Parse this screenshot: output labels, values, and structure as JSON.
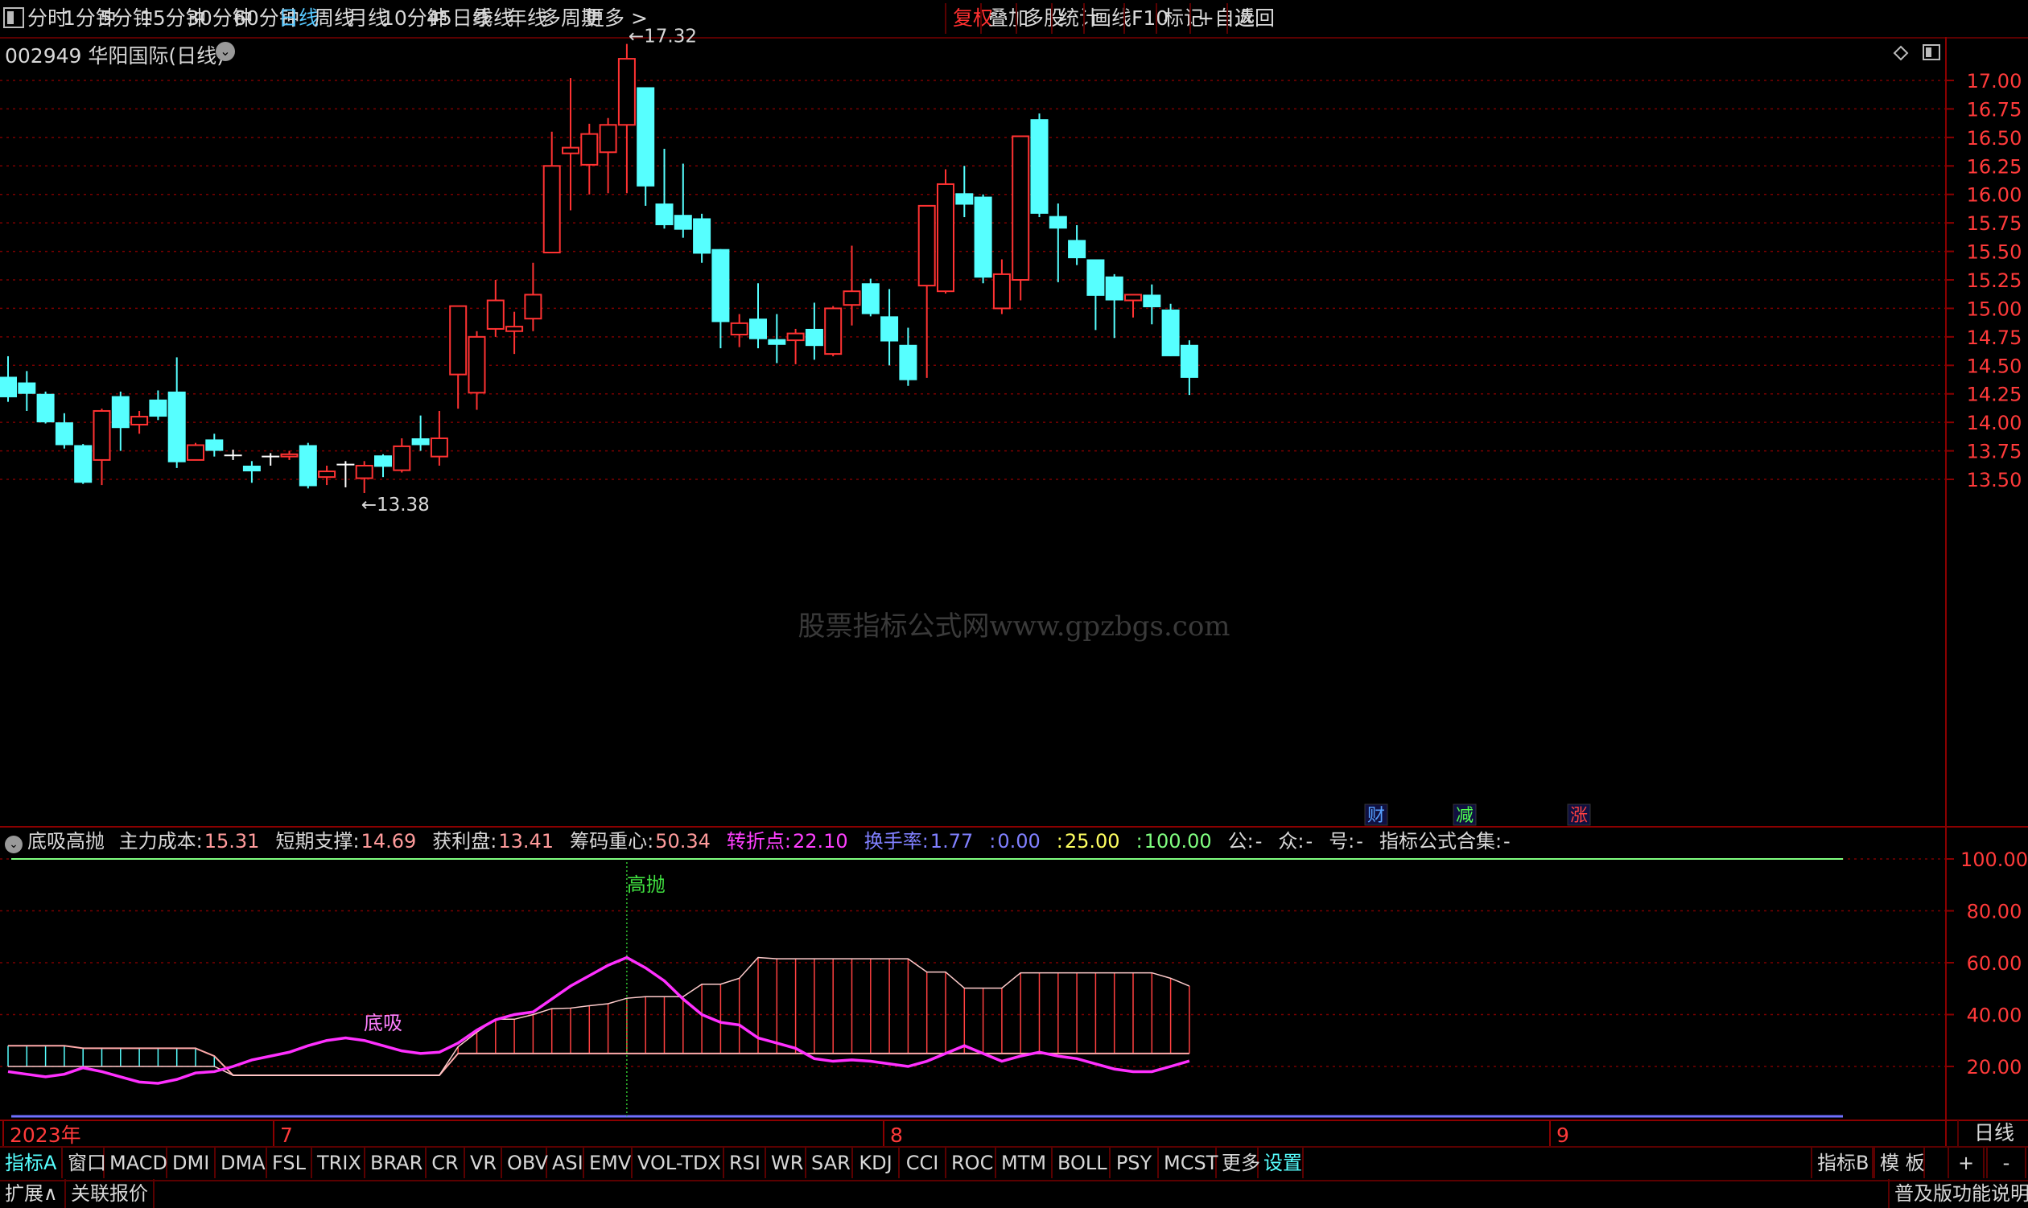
{
  "toolbar": {
    "periods": [
      "分时",
      "1分钟",
      "5分钟",
      "15分钟",
      "30分钟",
      "60分钟",
      "日线",
      "周线",
      "月线",
      "10分钟",
      "45日线",
      "季线",
      "年线",
      "多周期",
      "更多 >"
    ],
    "active_period": "日线",
    "right_buttons": [
      "复权",
      "叠加",
      "多股",
      "统计",
      "画线",
      "F10",
      "标记",
      "+自选",
      "返回"
    ]
  },
  "stock": {
    "code": "002949",
    "name": "华阳国际",
    "period": "(日线)"
  },
  "price_axis": {
    "labels": [
      "17.00",
      "16.75",
      "16.50",
      "16.25",
      "16.00",
      "15.75",
      "15.50",
      "15.25",
      "15.00",
      "14.75",
      "14.50",
      "14.25",
      "14.00",
      "13.75",
      "13.50"
    ],
    "min": 13.2,
    "max": 17.4
  },
  "annotations": {
    "high": "17.32",
    "low": "13.38",
    "markers": [
      "财",
      "减",
      "涨"
    ]
  },
  "watermark": "股票指标公式网www.gpzbgs.com",
  "indicator": {
    "name": "底吸高抛",
    "fields": [
      {
        "label": "主力成本:",
        "value": "15.31",
        "color": "#ff9b9b"
      },
      {
        "label": "短期支撑:",
        "value": "14.69",
        "color": "#ff9b9b"
      },
      {
        "label": "获利盘:",
        "value": "13.41",
        "color": "#ff9b9b"
      },
      {
        "label": "筹码重心:",
        "value": "50.34",
        "color": "#ff9b9b"
      },
      {
        "label": "转折点:",
        "value": "22.10",
        "color": "#ff40ff"
      },
      {
        "label": "换手率:",
        "value": "1.77",
        "color": "#8080ff"
      },
      {
        "label": ":",
        "value": "0.00",
        "color": "#8080ff"
      },
      {
        "label": ":",
        "value": "25.00",
        "color": "#ffff60"
      },
      {
        "label": ":",
        "value": "100.00",
        "color": "#80ff80"
      },
      {
        "label": "公:",
        "value": "-",
        "color": "#d8d8d8"
      },
      {
        "label": "众:",
        "value": "-",
        "color": "#d8d8d8"
      },
      {
        "label": "号:",
        "value": "-",
        "color": "#d8d8d8"
      },
      {
        "label": "指标公式合集:",
        "value": "-",
        "color": "#d8d8d8"
      }
    ],
    "axis_labels": [
      "100.00",
      "80.00",
      "60.00",
      "40.00",
      "20.00"
    ],
    "signal_buy": "底吸",
    "signal_sell": "高抛"
  },
  "date_axis": {
    "labels": [
      "2023年",
      "7",
      "8",
      "9"
    ],
    "period": "日线"
  },
  "tabs": [
    "指标A",
    "窗口",
    "MACD",
    "DMI",
    "DMA",
    "FSL",
    "TRIX",
    "BRAR",
    "CR",
    "VR",
    "OBV",
    "ASI",
    "EMV",
    "VOL-TDX",
    "RSI",
    "WR",
    "SAR",
    "KDJ",
    "CCI",
    "ROC",
    "MTM",
    "BOLL",
    "PSY",
    "MCST",
    "更多",
    "设置"
  ],
  "tabs_right": [
    "指标B",
    "模 板",
    "+",
    "-"
  ],
  "statusbar": {
    "left": [
      "扩展∧",
      "关联报价"
    ],
    "right": "普及版功能说明"
  },
  "chart_data": {
    "type": "candlestick",
    "candles": [
      [
        14.4,
        14.22,
        14.58,
        14.18
      ],
      [
        14.35,
        14.25,
        14.45,
        14.1
      ],
      [
        14.25,
        14.0,
        14.27,
        13.99
      ],
      [
        14.0,
        13.8,
        14.08,
        13.77
      ],
      [
        13.8,
        13.47,
        13.81,
        13.46
      ],
      [
        13.67,
        14.1,
        14.12,
        13.45
      ],
      [
        14.23,
        13.95,
        14.27,
        13.75
      ],
      [
        13.98,
        14.05,
        14.1,
        13.9
      ],
      [
        14.2,
        14.05,
        14.28,
        14.02
      ],
      [
        14.27,
        13.65,
        14.57,
        13.6
      ],
      [
        13.67,
        13.8,
        13.82,
        13.75
      ],
      [
        13.85,
        13.75,
        13.9,
        13.7
      ],
      [
        13.71,
        13.71,
        13.76,
        13.67
      ],
      [
        13.62,
        13.57,
        13.66,
        13.47
      ],
      [
        13.7,
        13.7,
        13.73,
        13.62
      ],
      [
        13.7,
        13.72,
        13.75,
        13.67
      ],
      [
        13.8,
        13.44,
        13.82,
        13.42
      ],
      [
        13.52,
        13.57,
        13.62,
        13.45
      ],
      [
        13.63,
        13.63,
        13.66,
        13.43
      ],
      [
        13.51,
        13.62,
        13.66,
        13.38
      ],
      [
        13.71,
        13.61,
        13.72,
        13.52
      ],
      [
        13.58,
        13.79,
        13.86,
        13.56
      ],
      [
        13.86,
        13.8,
        14.06,
        13.75
      ],
      [
        13.7,
        13.86,
        14.1,
        13.62
      ],
      [
        14.42,
        15.02,
        15.02,
        14.12
      ],
      [
        14.26,
        14.75,
        14.8,
        14.11
      ],
      [
        14.82,
        15.07,
        15.25,
        14.75
      ],
      [
        14.8,
        14.84,
        14.97,
        14.6
      ],
      [
        14.91,
        15.12,
        15.4,
        14.8
      ],
      [
        15.49,
        16.25,
        16.55,
        15.49
      ],
      [
        16.36,
        16.41,
        17.02,
        15.86
      ],
      [
        16.26,
        16.53,
        16.62,
        16.0
      ],
      [
        16.37,
        16.61,
        16.67,
        16.01
      ],
      [
        16.61,
        17.19,
        17.32,
        16.01
      ],
      [
        16.94,
        16.07,
        16.94,
        15.9
      ],
      [
        15.92,
        15.73,
        16.4,
        15.7
      ],
      [
        15.82,
        15.69,
        16.27,
        15.62
      ],
      [
        15.79,
        15.48,
        15.83,
        15.4
      ],
      [
        15.52,
        14.88,
        15.52,
        14.65
      ],
      [
        14.77,
        14.87,
        14.95,
        14.66
      ],
      [
        14.91,
        14.73,
        15.22,
        14.65
      ],
      [
        14.73,
        14.68,
        14.95,
        14.52
      ],
      [
        14.72,
        14.78,
        14.82,
        14.51
      ],
      [
        14.82,
        14.67,
        15.05,
        14.55
      ],
      [
        14.6,
        15.0,
        15.02,
        14.58
      ],
      [
        15.03,
        15.15,
        15.55,
        14.85
      ],
      [
        15.22,
        14.95,
        15.26,
        14.93
      ],
      [
        14.93,
        14.71,
        15.17,
        14.5
      ],
      [
        14.68,
        14.37,
        14.83,
        14.32
      ],
      [
        15.2,
        15.9,
        15.9,
        14.39
      ],
      [
        15.15,
        16.09,
        16.22,
        15.13
      ],
      [
        16.01,
        15.91,
        16.25,
        15.8
      ],
      [
        15.98,
        15.27,
        16.0,
        15.22
      ],
      [
        15.0,
        15.3,
        15.43,
        14.95
      ],
      [
        15.25,
        16.51,
        16.51,
        15.07
      ],
      [
        16.66,
        15.83,
        16.71,
        15.8
      ],
      [
        15.81,
        15.7,
        15.92,
        15.23
      ],
      [
        15.6,
        15.44,
        15.73,
        15.38
      ],
      [
        15.43,
        15.11,
        15.43,
        14.81
      ],
      [
        15.28,
        15.07,
        15.3,
        14.74
      ],
      [
        15.07,
        15.12,
        15.12,
        14.92
      ],
      [
        15.12,
        15.01,
        15.21,
        14.86
      ],
      [
        14.99,
        14.58,
        15.04,
        14.58
      ],
      [
        14.68,
        14.39,
        14.72,
        14.24
      ]
    ],
    "turnover_avg": [
      20.0,
      20.0,
      20.0,
      20.0,
      20.0,
      20.0,
      20.0,
      20.0,
      20.0,
      20.0,
      20.0,
      20.0,
      16.6,
      16.6,
      16.6,
      16.6,
      16.6,
      16.6,
      16.6,
      16.6,
      16.6,
      16.6,
      16.6,
      16.6,
      27.6,
      33.2,
      38.2,
      38.2,
      40.0,
      42.3,
      42.5,
      43.4,
      44.2,
      46.3,
      46.9,
      46.9,
      46.9,
      51.7,
      51.7,
      54.0,
      62.0,
      61.5,
      61.5,
      61.5,
      61.5,
      61.5,
      61.5,
      61.5,
      61.5,
      56.4,
      56.4,
      50.2,
      50.2,
      50.2,
      56.1,
      56.1,
      56.1,
      56.1,
      56.1,
      56.1,
      56.1,
      56.1,
      54.0,
      51.0
    ],
    "baseline": [
      28.0,
      28.0,
      28.0,
      28.0,
      27.0,
      27.0,
      27.0,
      27.0,
      27.0,
      27.0,
      27.0,
      24.0,
      16.6,
      16.6,
      16.6,
      16.6,
      16.6,
      16.6,
      16.6,
      16.6,
      16.6,
      16.6,
      16.6,
      16.6,
      25.0,
      25.0,
      25.0,
      25.0,
      25.0,
      25.0,
      25.0,
      25.0,
      25.0,
      25.0,
      25.0,
      25.0,
      25.0,
      25.0,
      25.0,
      25.0,
      25.0,
      25.0,
      25.0,
      25.0,
      25.0,
      25.0,
      25.0,
      25.0,
      25.0,
      25.0,
      25.0,
      25.0,
      25.0,
      25.0,
      25.0,
      25.0,
      25.0,
      25.0,
      25.0,
      25.0,
      25.0,
      25.0,
      25.0,
      25.0
    ],
    "turning_line": [
      18.0,
      17.0,
      16.0,
      17.0,
      19.5,
      18.0,
      16.0,
      14.0,
      13.5,
      15.0,
      17.5,
      18.0,
      20.0,
      22.5,
      24.0,
      25.5,
      28.0,
      30.0,
      31.0,
      30.0,
      28.0,
      26.0,
      25.0,
      25.5,
      29.0,
      34.0,
      38.0,
      40.0,
      41.0,
      46.0,
      51.0,
      55.0,
      59.0,
      62.0,
      58.0,
      53.0,
      46.0,
      40.0,
      37.0,
      36.0,
      31.0,
      29.0,
      27.0,
      23.0,
      22.0,
      22.5,
      22.0,
      21.0,
      20.0,
      22.0,
      25.0,
      28.0,
      25.0,
      22.0,
      24.0,
      25.5,
      24.0,
      23.0,
      21.0,
      19.0,
      18.0,
      18.0,
      20.0,
      22.1
    ],
    "upper_line": 100,
    "lower_line": 0,
    "buy_index": 20,
    "sell_index": 33
  }
}
